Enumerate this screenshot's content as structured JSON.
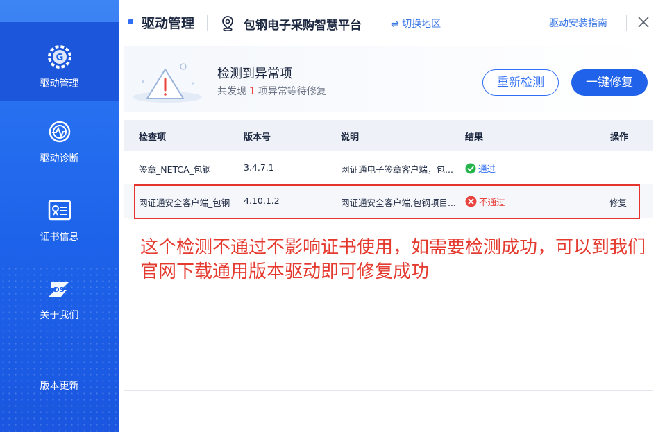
{
  "sidebar": {
    "items": [
      {
        "label": "驱动管理",
        "icon": "gear-icon",
        "active": true
      },
      {
        "label": "驱动诊断",
        "icon": "diagnosis-icon",
        "active": false
      },
      {
        "label": "证书信息",
        "icon": "certificate-icon",
        "active": false
      },
      {
        "label": "关于我们",
        "icon": "ds-logo-icon",
        "active": false
      },
      {
        "label": "版本更新",
        "icon": "",
        "active": false
      }
    ]
  },
  "header": {
    "title": "驱动管理",
    "platform": "包钢电子采购智慧平台",
    "switch_region": "⇌ 切换地区",
    "install_guide": "驱动安装指南"
  },
  "banner": {
    "title": "检测到异常项",
    "sub_prefix": "共发现",
    "count": "1",
    "sub_suffix": "项异常等待修复",
    "recheck_label": "重新检测",
    "fix_all_label": "一键修复"
  },
  "table": {
    "headers": [
      "检查项",
      "版本号",
      "说明",
      "结果",
      "操作"
    ],
    "rows": [
      {
        "item": "签章_NETCA_包钢",
        "version": "3.4.7.1",
        "desc": "网证通电子签章客户端，包...",
        "result": "通过",
        "status": "pass",
        "action": ""
      },
      {
        "item": "网证通安全客户端_包钢",
        "version": "4.10.1.2",
        "desc": "网证通安全客户端,包钢项目...",
        "result": "不通过",
        "status": "fail",
        "action": "修复"
      }
    ]
  },
  "annotation": "这个检测不通过不影响证书使用，如需要检测成功，可以到我们官网下载通用版本驱动即可修复成功",
  "colors": {
    "sidebar": "#1f63eb",
    "accent": "#2f6ef5",
    "error": "#e8433e",
    "success": "#25b34b"
  }
}
